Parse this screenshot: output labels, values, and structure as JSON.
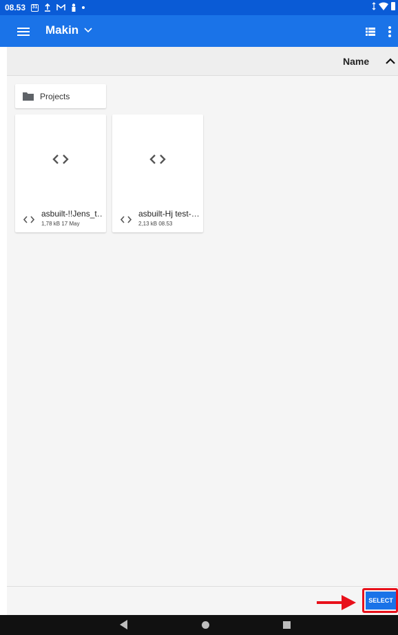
{
  "status_bar": {
    "time": "08.53",
    "calendar_day": "31",
    "icons": [
      "calendar-icon",
      "upload-icon",
      "gmail-icon",
      "person-icon",
      "dot-icon",
      "data-arrows-icon",
      "wifi-icon",
      "battery-icon"
    ]
  },
  "app_bar": {
    "title": "Makin",
    "menu_icon": "hamburger-menu-icon",
    "dropdown_icon": "chevron-down-icon",
    "view_toggle_icon": "list-view-icon",
    "overflow_icon": "more-vert-icon"
  },
  "sort_bar": {
    "label": "Name",
    "direction_icon": "chevron-up-icon"
  },
  "folders": [
    {
      "name": "Projects",
      "icon": "folder-icon"
    }
  ],
  "files": [
    {
      "name": "asbuilt-!!Jens_t…",
      "meta": "1,78 kB 17 May",
      "icon": "code-icon"
    },
    {
      "name": "asbuilt-Hj test-…",
      "meta": "2,13 kB 08.53",
      "icon": "code-icon"
    }
  ],
  "action_bar": {
    "select_label": "SELECT"
  },
  "colors": {
    "status_bar": "#0a5bd6",
    "app_bar": "#1a73e8",
    "select_button": "#1a73e8",
    "highlight": "#e8101a",
    "background": "#f5f5f5",
    "nav_bar": "#111111"
  },
  "nav_bar": {
    "icons": [
      "back-icon",
      "home-icon",
      "recents-icon"
    ]
  }
}
